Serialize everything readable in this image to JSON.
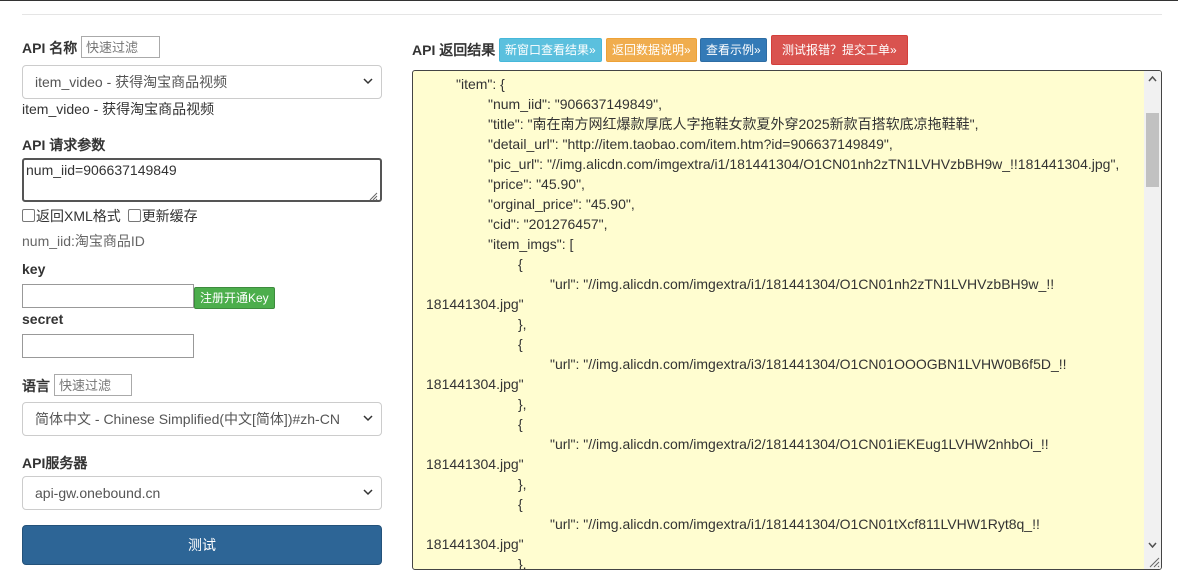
{
  "left": {
    "api_name_label": "API 名称",
    "api_name_filter_placeholder": "快速过滤",
    "api_select_value": "item_video - 获得淘宝商品视频",
    "api_description": "item_video - 获得淘宝商品视频",
    "params_label": "API 请求参数",
    "params_value": "num_iid=906637149849",
    "xml_checkbox_label": "返回XML格式",
    "cache_checkbox_label": "更新缓存",
    "param_hint": "num_iid:淘宝商品ID",
    "key_label": "key",
    "register_key_button": "注册开通Key",
    "secret_label": "secret",
    "lang_label": "语言",
    "lang_filter_placeholder": "快速过滤",
    "lang_select_value": "简体中文 - Chinese Simplified(中文[简体])#zh-CN",
    "server_label": "API服务器",
    "server_select_value": "api-gw.onebound.cn",
    "test_button": "测试"
  },
  "right": {
    "result_label": "API 返回结果",
    "buttons": [
      {
        "label": "新窗口查看结果»",
        "color": "#5bc0de"
      },
      {
        "label": "返回数据说明»",
        "color": "#f0ad4e"
      },
      {
        "label": "查看示例»",
        "color": "#337ab7"
      },
      {
        "label": "测试报错？提交工单»",
        "color": "#d9534f"
      }
    ],
    "result_lines": [
      "\"item\": {",
      "\"num_iid\": \"906637149849\",",
      "\"title\": \"南在南方网红爆款厚底人字拖鞋女款夏外穿2025新款百搭软底凉拖鞋鞋\",",
      "\"detail_url\": \"http://item.taobao.com/item.htm?id=906637149849\",",
      "\"pic_url\": \"//img.alicdn.com/imgextra/i1/181441304/O1CN01nh2zTN1LVHVzbBH9w_!!181441304.jpg\",",
      "\"price\": \"45.90\",",
      "\"orginal_price\": \"45.90\",",
      "\"cid\": \"201276457\",",
      "\"item_imgs\": [",
      "{",
      "\"url\": \"//img.alicdn.com/imgextra/i1/181441304/O1CN01nh2zTN1LVHVzbBH9w_!!",
      "181441304.jpg\"",
      "},",
      "{",
      "\"url\": \"//img.alicdn.com/imgextra/i3/181441304/O1CN01OOOGBN1LVHW0B6f5D_!!",
      "181441304.jpg\"",
      "},",
      "{",
      "\"url\": \"//img.alicdn.com/imgextra/i2/181441304/O1CN01iEKEug1LVHW2nhbOi_!!",
      "181441304.jpg\"",
      "},",
      "{",
      "\"url\": \"//img.alicdn.com/imgextra/i1/181441304/O1CN01tXcf811LVHW1Ryt8q_!!",
      "181441304.jpg\"",
      "},"
    ]
  }
}
